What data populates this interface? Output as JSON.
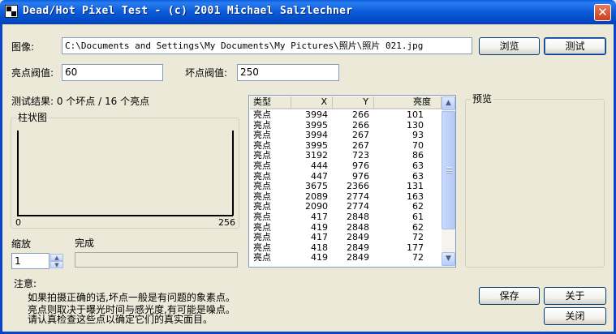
{
  "window": {
    "title": "Dead/Hot Pixel Test - (c) 2001 Michael Salzlechner"
  },
  "image": {
    "label": "图像:",
    "path": "C:\\Documents and Settings\\My Documents\\My Pictures\\照片\\照片 021.jpg",
    "browse_label": "浏览",
    "test_label": "测试"
  },
  "thresholds": {
    "hot_label": "亮点阀值:",
    "hot_value": "60",
    "dead_label": "坏点阀值:",
    "dead_value": "250"
  },
  "result": {
    "text": "测试结果:  0 个坏点 / 16 个亮点"
  },
  "histogram": {
    "title": "柱状图",
    "axis_min": "0",
    "axis_max": "256"
  },
  "zoom": {
    "label": "缩放",
    "value": "1"
  },
  "progress": {
    "label": "完成",
    "fraction": 0.0
  },
  "pixel_list": {
    "columns": [
      "类型",
      "X",
      "Y",
      "亮度"
    ],
    "rows": [
      [
        "亮点",
        "3994",
        "266",
        "101"
      ],
      [
        "亮点",
        "3995",
        "266",
        "130"
      ],
      [
        "亮点",
        "3994",
        "267",
        "93"
      ],
      [
        "亮点",
        "3995",
        "267",
        "70"
      ],
      [
        "亮点",
        "3192",
        "723",
        "86"
      ],
      [
        "亮点",
        "444",
        "976",
        "63"
      ],
      [
        "亮点",
        "447",
        "976",
        "63"
      ],
      [
        "亮点",
        "3675",
        "2366",
        "131"
      ],
      [
        "亮点",
        "2089",
        "2774",
        "163"
      ],
      [
        "亮点",
        "2090",
        "2774",
        "62"
      ],
      [
        "亮点",
        "417",
        "2848",
        "61"
      ],
      [
        "亮点",
        "419",
        "2848",
        "62"
      ],
      [
        "亮点",
        "417",
        "2849",
        "72"
      ],
      [
        "亮点",
        "418",
        "2849",
        "177"
      ],
      [
        "亮点",
        "419",
        "2849",
        "72"
      ]
    ]
  },
  "preview": {
    "title": "预览"
  },
  "notes": {
    "heading": "注意:",
    "line1": "如果拍摄正确的话,坏点一般是有问题的象素点。",
    "line2": "亮点则取决于曝光时间与感光度,有可能是噪点。",
    "line3": "请认真检查这些点以确定它们的真实面目。"
  },
  "buttons": {
    "save": "保存",
    "about": "关于",
    "close": "关闭"
  },
  "colors": {
    "titlebar": "#0a5bd8",
    "dialog_bg": "#ece9d8",
    "close_button": "#d9572f"
  }
}
